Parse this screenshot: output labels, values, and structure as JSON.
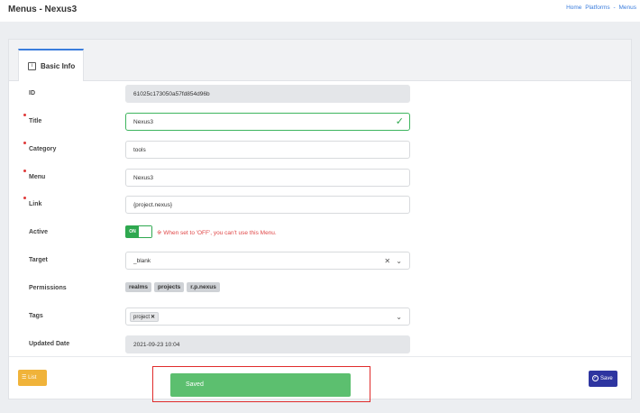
{
  "header": {
    "title": "Menus - Nexus3",
    "breadcrumb": [
      "Home",
      "Platforms",
      "-",
      "Menus"
    ]
  },
  "tab": {
    "label": "Basic Info"
  },
  "form": {
    "id_label": "ID",
    "id_value": "61025c173050a57fd854d96b",
    "title_label": "Title",
    "title_value": "Nexus3",
    "category_label": "Category",
    "category_value": "tools",
    "menu_label": "Menu",
    "menu_value": "Nexus3",
    "link_label": "Link",
    "link_value": "{project.nexus}",
    "active_label": "Active",
    "active_state": "ON",
    "active_note": "※ When set to 'OFF', you can't use this Menu.",
    "target_label": "Target",
    "target_value": "_blank",
    "permissions_label": "Permissions",
    "permissions": [
      "realms",
      "projects",
      "r.p.nexus"
    ],
    "tags_label": "Tags",
    "tags": [
      "project"
    ],
    "updated_label": "Updated Date",
    "updated_value": "2021-09-23 10:04"
  },
  "footer": {
    "list_label": "List",
    "save_label": "Save"
  },
  "toast": {
    "message": "Saved"
  },
  "colors": {
    "accent": "#3b7ddd",
    "success": "#2ea84f",
    "save": "#2e35a0",
    "list": "#f0b33a",
    "toast": "#5cbf6f"
  }
}
